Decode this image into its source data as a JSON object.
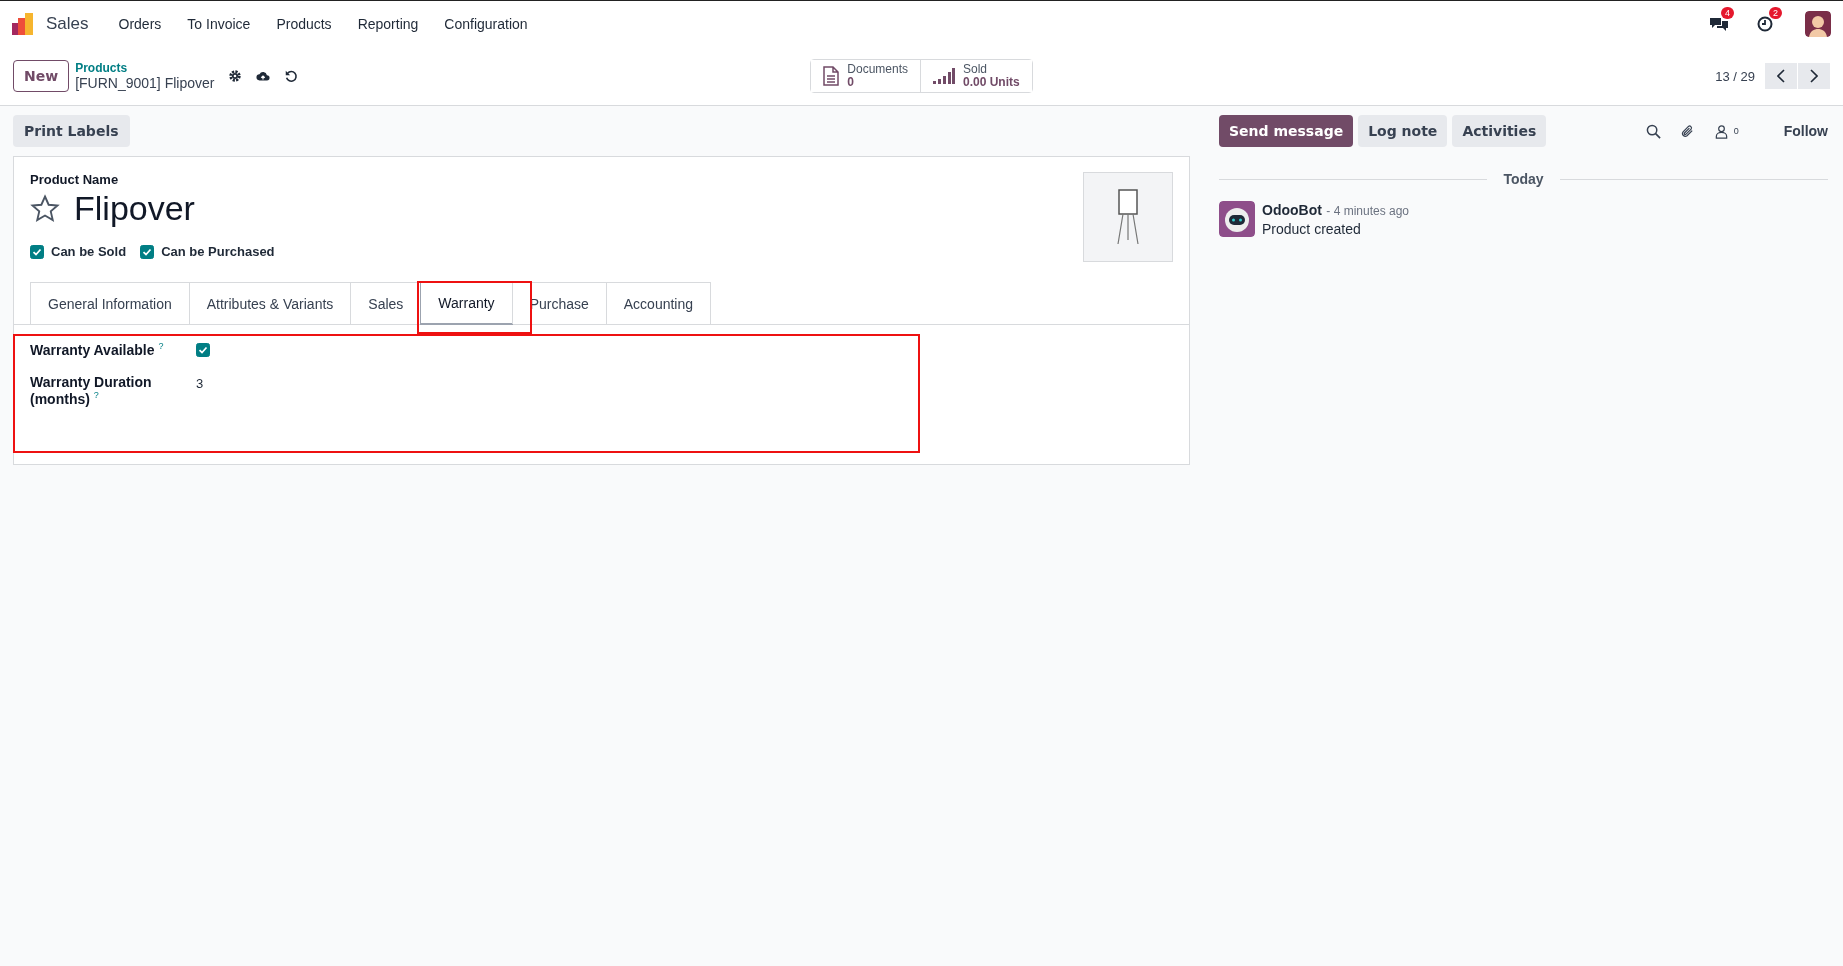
{
  "app": {
    "name": "Sales"
  },
  "menu": [
    "Orders",
    "To Invoice",
    "Products",
    "Reporting",
    "Configuration"
  ],
  "systray": {
    "messages_badge": "4",
    "activities_badge": "2"
  },
  "control_panel": {
    "new_button": "New",
    "breadcrumb": "Products",
    "record_title": "[FURN_9001] Flipover",
    "pager": "13 / 29"
  },
  "smart_buttons": [
    {
      "kind": "document",
      "label": "Documents",
      "value": "0"
    },
    {
      "kind": "chart",
      "label": "Sold",
      "value": "0.00 Units"
    }
  ],
  "actions": [
    "Print Labels"
  ],
  "form": {
    "name_label": "Product Name",
    "name": "Flipover",
    "starred": false,
    "flags": [
      {
        "label": "Can be Sold",
        "checked": true
      },
      {
        "label": "Can be Purchased",
        "checked": true
      }
    ],
    "tabs": [
      {
        "label": "General Information",
        "selected": false
      },
      {
        "label": "Attributes & Variants",
        "selected": false
      },
      {
        "label": "Sales",
        "selected": false
      },
      {
        "label": "Warranty",
        "selected": true
      },
      {
        "label": "Purchase",
        "selected": false
      },
      {
        "label": "Accounting",
        "selected": false
      }
    ],
    "fields": [
      {
        "kind": "checkbox",
        "label": "Warranty Available",
        "help": "?",
        "checked": true
      },
      {
        "kind": "text",
        "label": "Warranty Duration (months)",
        "help": "?",
        "value": "3"
      }
    ]
  },
  "chatter": {
    "buttons": [
      {
        "label": "Send message",
        "selected": true
      },
      {
        "label": "Log note",
        "selected": false
      },
      {
        "label": "Activities",
        "selected": false
      }
    ],
    "followers_count": "0",
    "follow": "Follow",
    "date_separator": "Today",
    "messages": [
      {
        "author": "OdooBot",
        "time": "- 4 minutes ago",
        "body": "Product created"
      }
    ]
  }
}
